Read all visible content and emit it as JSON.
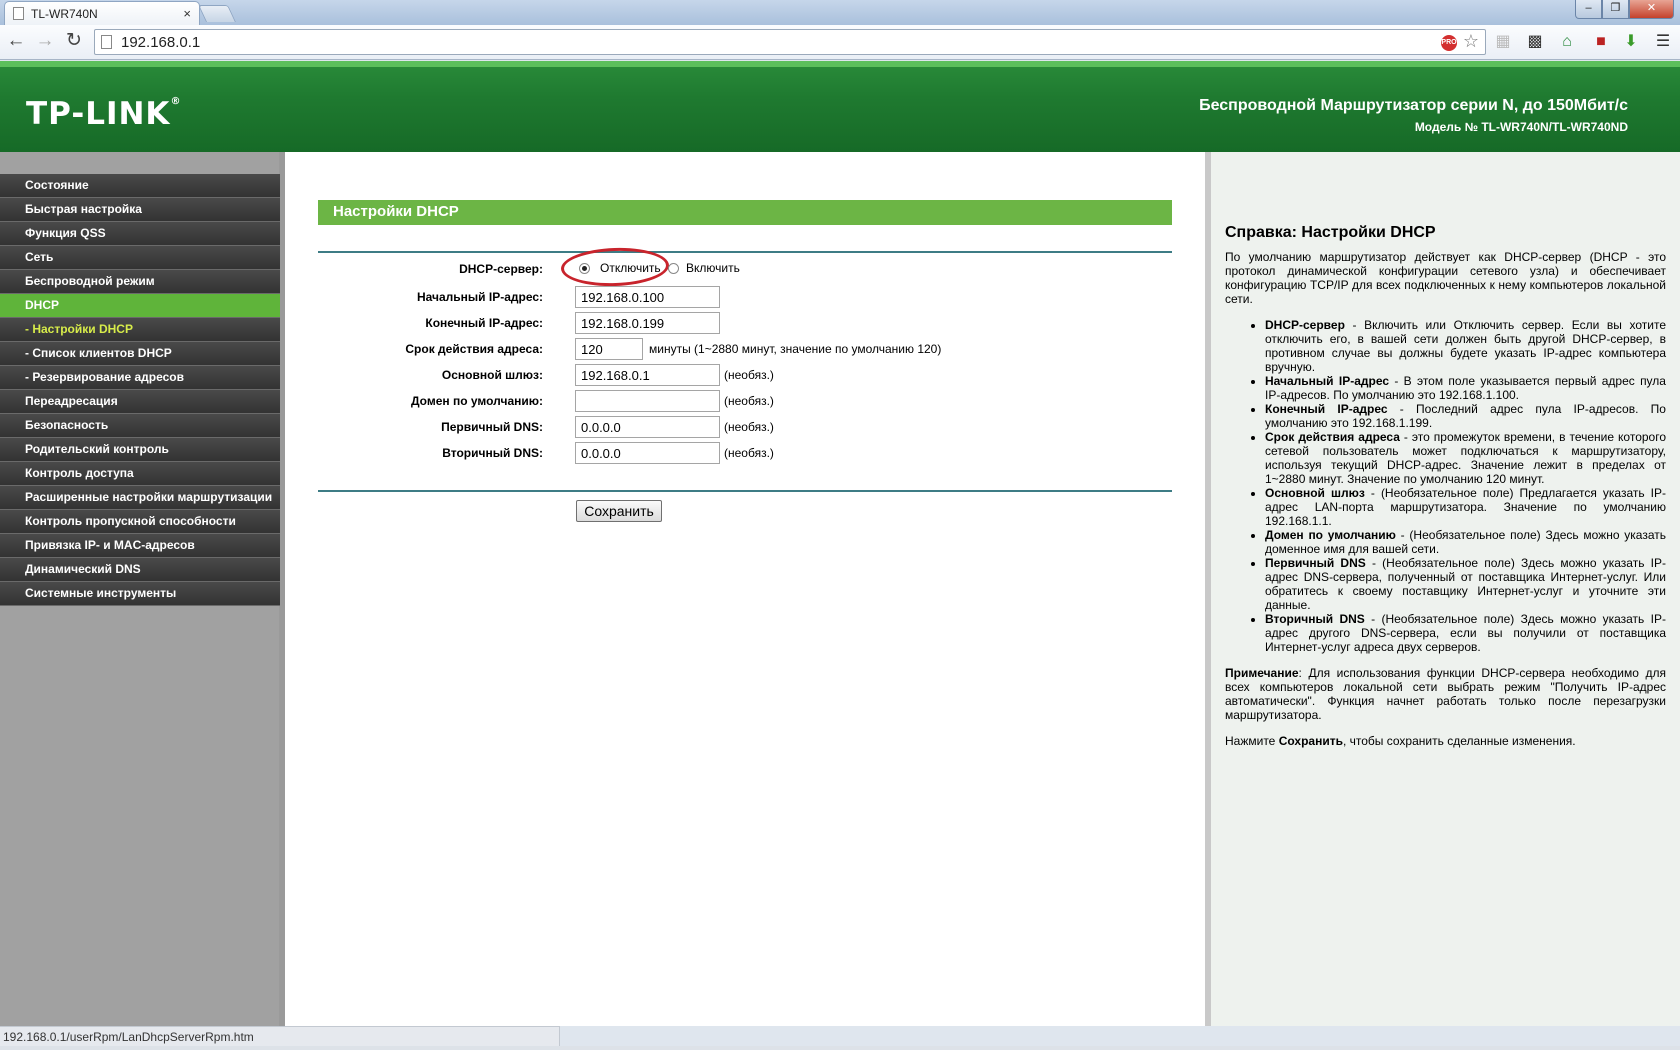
{
  "browser": {
    "tab_title": "TL-WR740N",
    "tab_close": "×",
    "url": "192.168.0.1",
    "pro_badge": "PRO",
    "window_controls": {
      "minimize": "–",
      "maximize": "❐",
      "close": "✕"
    },
    "status_url": "192.168.0.1/userRpm/LanDhcpServerRpm.htm"
  },
  "header": {
    "logo": "TP-LINK",
    "logo_mark": "®",
    "title": "Беспроводной Маршрутизатор серии N, до 150Мбит/с",
    "model": "Модель № TL-WR740N/TL-WR740ND"
  },
  "menu": {
    "items": [
      {
        "label": "Состояние"
      },
      {
        "label": "Быстрая настройка"
      },
      {
        "label": "Функция QSS"
      },
      {
        "label": "Сеть"
      },
      {
        "label": "Беспроводной режим"
      },
      {
        "label": "DHCP"
      },
      {
        "label": "- Настройки DHCP"
      },
      {
        "label": "- Список клиентов DHCP"
      },
      {
        "label": "- Резервирование адресов"
      },
      {
        "label": "Переадресация"
      },
      {
        "label": "Безопасность"
      },
      {
        "label": "Родительский контроль"
      },
      {
        "label": "Контроль доступа"
      },
      {
        "label": "Расширенные настройки маршрутизации"
      },
      {
        "label": "Контроль пропускной способности"
      },
      {
        "label": "Привязка IP- и MAC-адресов"
      },
      {
        "label": "Динамический DNS"
      },
      {
        "label": "Системные инструменты"
      }
    ]
  },
  "form": {
    "title": "Настройки DHCP",
    "dhcp_server_label": "DHCP-сервер:",
    "disable_label": "Отключить",
    "enable_label": "Включить",
    "start_ip_label": "Начальный IP-адрес:",
    "start_ip": "192.168.0.100",
    "end_ip_label": "Конечный IP-адрес:",
    "end_ip": "192.168.0.199",
    "lease_label": "Срок действия адреса:",
    "lease": "120",
    "lease_note": "минуты (1~2880 минут, значение по умолчанию 120)",
    "gateway_label": "Основной шлюз:",
    "gateway": "192.168.0.1",
    "domain_label": "Домен по умолчанию:",
    "domain": "",
    "dns1_label": "Первичный DNS:",
    "dns1": "0.0.0.0",
    "dns2_label": "Вторичный DNS:",
    "dns2": "0.0.0.0",
    "optional_note": "(необяз.)",
    "save_label": "Сохранить"
  },
  "help": {
    "title": "Справка: Настройки DHCP",
    "intro": "По умолчанию маршрутизатор действует как DHCP-сервер (DHCP - это протокол динамической конфигурации сетевого узла) и обеспечивает конфигурацию TCP/IP для всех подключенных к нему компьютеров локальной сети.",
    "items": [
      {
        "term": "DHCP-сервер",
        "text": " - Включить или Отключить сервер. Если вы хотите отключить его, в вашей сети должен быть другой DHCP-сервер, в противном случае вы должны будете указать IP-адрес компьютера вручную."
      },
      {
        "term": "Начальный IP-адрес",
        "text": " - В этом поле указывается первый адрес пула IP-адресов. По умолчанию это 192.168.1.100."
      },
      {
        "term": "Конечный IP-адрес",
        "text": " - Последний адрес пула IP-адресов. По умолчанию это 192.168.1.199."
      },
      {
        "term": "Срок действия адреса",
        "text": " - это промежуток времени, в течение которого сетевой пользователь может подключаться к маршрутизатору, используя текущий DHCP-адрес. Значение лежит в пределах от 1~2880 минут. Значение по умолчанию 120 минут."
      },
      {
        "term": "Основной шлюз",
        "text": " - (Необязательное поле) Предлагается указать IP-адрес LAN-порта маршрутизатора. Значение по умолчанию 192.168.1.1."
      },
      {
        "term": "Домен по умолчанию",
        "text": " - (Необязательное поле) Здесь можно указать доменное имя для вашей сети."
      },
      {
        "term": "Первичный DNS",
        "text": " - (Необязательное поле) Здесь можно указать IP-адрес DNS-сервера, полученный от поставщика Интернет-услуг. Или обратитесь к своему поставщику Интернет-услуг и уточните эти данные."
      },
      {
        "term": "Вторичный DNS",
        "text": " - (Необязательное поле) Здесь можно указать IP-адрес другого DNS-сервера, если вы получили от поставщика Интернет-услуг адреса двух серверов."
      }
    ],
    "note_term": "Примечание",
    "note_text": ": Для использования функции DHCP-сервера необходимо для всех компьютеров локальной сети выбрать режим \"Получить IP-адрес автоматически\". Функция начнет работать только после перезагрузки маршрутизатора.",
    "save_prefix": "Нажмите ",
    "save_term": "Сохранить",
    "save_suffix": ", чтобы сохранить сделанные изменения."
  },
  "icons": [
    "page-icon",
    "back-icon",
    "forward-icon",
    "reload-icon",
    "star-icon",
    "close-icon",
    "download-icon",
    "home-icon"
  ],
  "colors": {
    "menu_active": "#5fb43a",
    "submenu_active_text": "#d7ec4a",
    "header_green": "#1f7a30",
    "section_bar": "#6cb545",
    "annotation_red": "#c8242c"
  }
}
